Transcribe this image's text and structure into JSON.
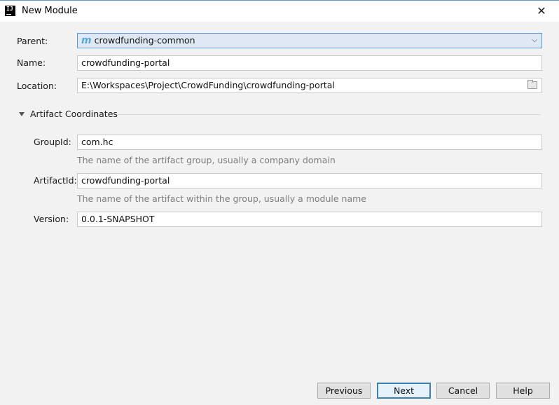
{
  "window": {
    "title": "New Module",
    "icon": "intellij-icon",
    "icon_text": "IJ",
    "close_glyph": "✕"
  },
  "form": {
    "parent": {
      "label": "Parent:",
      "icon": "m",
      "value": "crowdfunding-common",
      "dropdown_glyph": "⌵"
    },
    "name": {
      "label": "Name:",
      "value": "crowdfunding-portal"
    },
    "location": {
      "label": "Location:",
      "value": "E:\\Workspaces\\Project\\CrowdFunding\\crowdfunding-portal"
    }
  },
  "artifact": {
    "section_label": "Artifact Coordinates",
    "group_id": {
      "label": "GroupId:",
      "value": "com.hc",
      "hint": "The name of the artifact group, usually a company domain"
    },
    "artifact_id": {
      "label": "ArtifactId:",
      "value": "crowdfunding-portal",
      "hint": "The name of the artifact within the group, usually a module name"
    },
    "version": {
      "label": "Version:",
      "value": "0.0.1-SNAPSHOT"
    }
  },
  "buttons": {
    "previous": "Previous",
    "next": "Next",
    "cancel": "Cancel",
    "help": "Help"
  },
  "colors": {
    "accent": "#5b9bd5",
    "background": "#f2f2f2",
    "hint": "#7d7d7d",
    "maven_icon": "#5aa6d6"
  }
}
